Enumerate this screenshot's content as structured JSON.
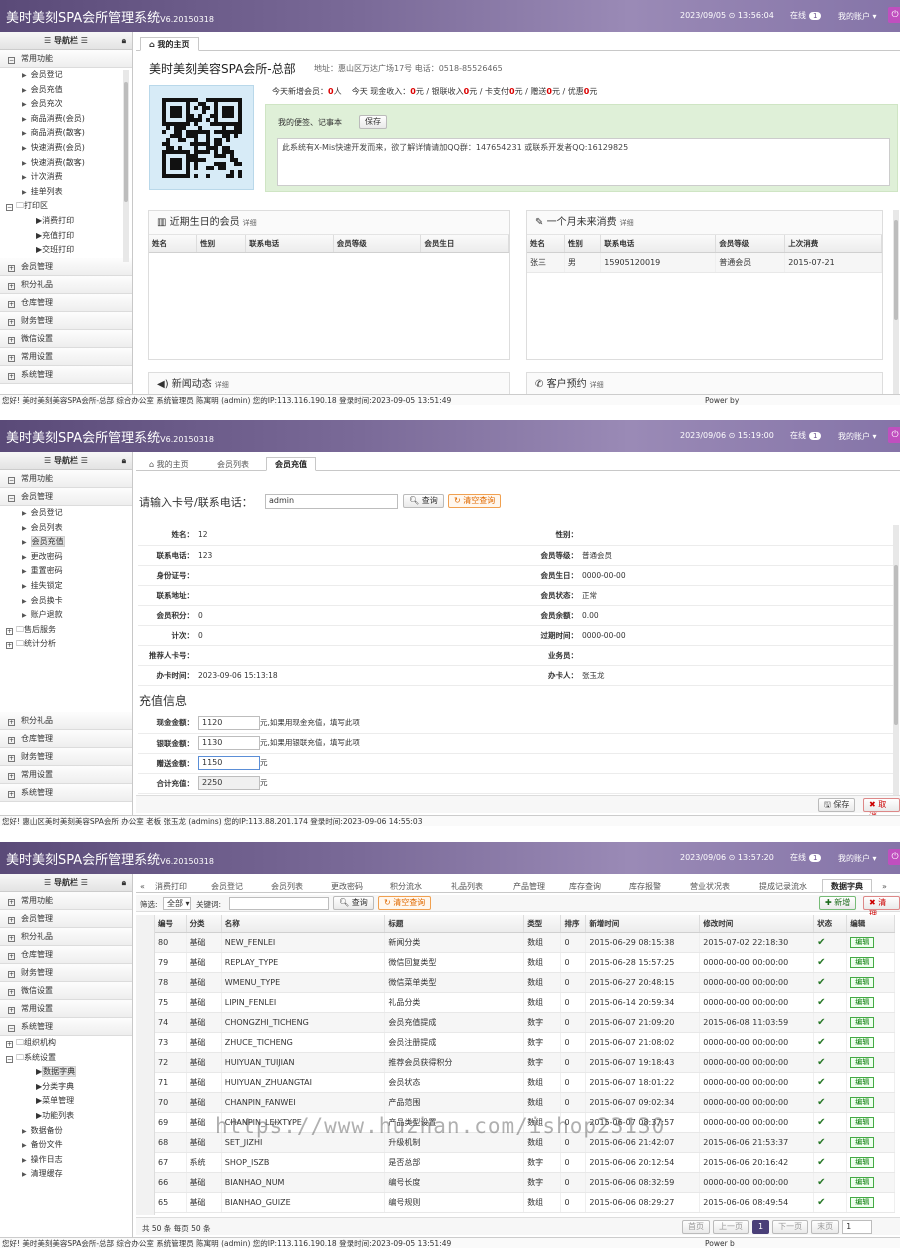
{
  "app_title": "美时美刻SPA会所管理系统",
  "app_version": "V6.20150318",
  "nav_header": "导航栏",
  "online_label": "在线",
  "account_label": "我的账户",
  "s1": {
    "datetime": "2023/09/05 ⊙ 13:56:04",
    "online_count": "1",
    "groups_top": [
      "常用功能"
    ],
    "sub_items": [
      "会员登记",
      "会员充值",
      "会员充次",
      "商品消费(会员)",
      "商品消费(散客)",
      "快速消费(会员)",
      "快速消费(散客)",
      "计次消费",
      "挂单列表"
    ],
    "print_folder": "打印区",
    "print_items": [
      "消费打印",
      "充值打印",
      "交班打印"
    ],
    "groups_bottom": [
      "会员管理",
      "积分礼品",
      "仓库管理",
      "财务管理",
      "微信设置",
      "常用设置",
      "系统管理"
    ],
    "tab": "我的主页",
    "store_name": "美时美刻美容SPA会所-总部",
    "address": "地址：惠山区万达广场17号 电话：0518-85526465",
    "stats": {
      "new_members_label": "今天新增会员：",
      "new_members": "0",
      "new_members_unit": "人",
      "cash_label": "今天 现金收入：",
      "cash": "0",
      "unit": "元",
      "union_label": "/ 银联收入",
      "union": "0",
      "card_label": "/ 卡支付",
      "card": "0",
      "gift_label": "/ 赠送",
      "gift": "0",
      "discount_label": "/ 优惠",
      "discount": "0"
    },
    "memo_label": "我的便签、记事本",
    "memo_save": "保存",
    "memo_text": "此系统有X-Mis快速开发而来，欲了解详情请加QQ群：147654231  或联系开发者QQ:16129825",
    "birthday_title": "近期生日的会员",
    "detail": "详细",
    "birthday_cols": [
      "姓名",
      "性别",
      "联系电话",
      "会员等级",
      "会员生日"
    ],
    "consume_title": "一个月未来消费",
    "consume_cols": [
      "姓名",
      "性别",
      "联系电话",
      "会员等级",
      "上次消费"
    ],
    "consume_rows": [
      [
        "张三",
        "男",
        "15905120019",
        "普通会员",
        "2015-07-21"
      ]
    ],
    "news_title": "新闻动态",
    "appoint_title": "客户预约",
    "status": "您好! 美时美刻美容SPA会所-总部 综合办公室 系统管理员 陈寓明 (admin) 您的IP:113.116.190.18 登录时间:2023-09-05 13:51:49",
    "powered": "Power by"
  },
  "s2": {
    "datetime": "2023/09/06 ⊙ 15:19:00",
    "online_count": "1",
    "groups_top": [
      "常用功能",
      "会员管理"
    ],
    "sub_items": [
      "会员登记",
      "会员列表",
      "会员充值",
      "更改密码",
      "重置密码",
      "挂失锁定",
      "会员换卡",
      "账户退款"
    ],
    "folders": [
      "售后服务",
      "统计分析"
    ],
    "groups_bottom": [
      "积分礼品",
      "仓库管理",
      "财务管理",
      "常用设置",
      "系统管理"
    ],
    "tabs": [
      "我的主页",
      "会员列表",
      "会员充值"
    ],
    "search_label": "请输入卡号/联系电话：",
    "search_value": "admin",
    "query": "查询",
    "clear": "清空查询",
    "info": [
      [
        "姓名：",
        "12",
        "性别：",
        ""
      ],
      [
        "联系电话：",
        "123",
        "会员等级：",
        "普通会员"
      ],
      [
        "身份证号：",
        "",
        "会员生日：",
        "0000-00-00"
      ],
      [
        "联系地址：",
        "",
        "会员状态：",
        "正常"
      ],
      [
        "会员积分：",
        "0",
        "会员余额：",
        "0.00"
      ],
      [
        "计次：",
        "0",
        "过期时间：",
        "0000-00-00"
      ],
      [
        "推荐人卡号：",
        "",
        "业务员：",
        ""
      ],
      [
        "办卡时间：",
        "2023-09-06 15:13:18",
        "办卡人：",
        "张玉龙"
      ]
    ],
    "recharge_title": "充值信息",
    "recharge": [
      {
        "label": "现金金额：",
        "value": "1120",
        "note": "元,如果用现金充值，填写此项"
      },
      {
        "label": "银联金额：",
        "value": "1130",
        "note": "元,如果用银联充值，填写此项"
      },
      {
        "label": "赠送金额：",
        "value": "1150",
        "note": "元"
      },
      {
        "label": "合计充值：",
        "value": "2250",
        "note": "元"
      }
    ],
    "save": "保存",
    "cancel": "取消",
    "status": "您好! 惠山区美时美刻美容SPA会所 办公室 老板 张玉龙 (admins) 您的IP:113.88.201.174 登录时间:2023-09-06 14:55:03"
  },
  "s3": {
    "datetime": "2023/09/06 ⊙ 13:57:20",
    "online_count": "1",
    "groups": [
      "常用功能",
      "会员管理",
      "积分礼品",
      "仓库管理",
      "财务管理",
      "微信设置",
      "常用设置",
      "系统管理"
    ],
    "folders": [
      "组织机构",
      "系统设置"
    ],
    "settings_items": [
      "数据字典",
      "分类字典",
      "菜单管理",
      "功能列表"
    ],
    "other_items": [
      "数据备份",
      "备份文件",
      "操作日志",
      "清理缓存"
    ],
    "tabs": [
      "消费打印",
      "会员登记",
      "会员列表",
      "更改密码",
      "积分流水",
      "礼品列表",
      "产品管理",
      "库存查询",
      "库存报警",
      "营业状况表",
      "提成记录流水",
      "数据字典"
    ],
    "filter_label": "筛选:",
    "filter_value": "全部",
    "keyword_label": "关键词:",
    "query": "查询",
    "clear": "清空查询",
    "add": "新增",
    "clean": "清理",
    "cols": [
      "编号",
      "分类",
      "名称",
      "标题",
      "类型",
      "排序",
      "新增时间",
      "修改时间",
      "状态",
      "编辑"
    ],
    "edit_label": "编辑",
    "rows": [
      [
        "80",
        "基础",
        "NEW_FENLEI",
        "新闻分类",
        "数组",
        "0",
        "2015-06-29 08:15:38",
        "2015-07-02 22:18:30"
      ],
      [
        "79",
        "基础",
        "REPLAY_TYPE",
        "微信回复类型",
        "数组",
        "0",
        "2015-06-28 15:57:25",
        "0000-00-00 00:00:00"
      ],
      [
        "78",
        "基础",
        "WMENU_TYPE",
        "微信菜单类型",
        "数组",
        "0",
        "2015-06-27 20:48:15",
        "0000-00-00 00:00:00"
      ],
      [
        "75",
        "基础",
        "LIPIN_FENLEI",
        "礼品分类",
        "数组",
        "0",
        "2015-06-14 20:59:34",
        "0000-00-00 00:00:00"
      ],
      [
        "74",
        "基础",
        "CHONGZHI_TICHENG",
        "会员充值提成",
        "数字",
        "0",
        "2015-06-07 21:09:20",
        "2015-06-08 11:03:59"
      ],
      [
        "73",
        "基础",
        "ZHUCE_TICHENG",
        "会员注册提成",
        "数字",
        "0",
        "2015-06-07 21:08:02",
        "0000-00-00 00:00:00"
      ],
      [
        "72",
        "基础",
        "HUIYUAN_TUIJIAN",
        "推荐会员获得积分",
        "数字",
        "0",
        "2015-06-07 19:18:43",
        "0000-00-00 00:00:00"
      ],
      [
        "71",
        "基础",
        "HUIYUAN_ZHUANGTAI",
        "会员状态",
        "数组",
        "0",
        "2015-06-07 18:01:22",
        "0000-00-00 00:00:00"
      ],
      [
        "70",
        "基础",
        "CHANPIN_FANWEI",
        "产品范围",
        "数组",
        "0",
        "2015-06-07 09:02:34",
        "0000-00-00 00:00:00"
      ],
      [
        "69",
        "基础",
        "CHANPIN_LEIXTYPE",
        "产品类型设置",
        "数组",
        "0",
        "2015-06-07 08:37:57",
        "0000-00-00 00:00:00"
      ],
      [
        "68",
        "基础",
        "SET_JIZHI",
        "升级机制",
        "数组",
        "0",
        "2015-06-06 21:42:07",
        "2015-06-06 21:53:37"
      ],
      [
        "67",
        "系统",
        "SHOP_ISZB",
        "是否总部",
        "数字",
        "0",
        "2015-06-06 20:12:54",
        "2015-06-06 20:16:42"
      ],
      [
        "66",
        "基础",
        "BIANHAO_NUM",
        "编号长度",
        "数字",
        "0",
        "2015-06-06 08:32:59",
        "0000-00-00 00:00:00"
      ],
      [
        "65",
        "基础",
        "BIANHAO_GUIZE",
        "编号规则",
        "数组",
        "0",
        "2015-06-06 08:29:27",
        "2015-06-06 08:49:54"
      ]
    ],
    "footer": "共 50 条 每页 50 条",
    "pager": [
      "首页",
      "上一页",
      "1",
      "下一页",
      "末页"
    ],
    "page_input": "1",
    "watermark": "https://www.huzhan.com/ishop23130",
    "status": "您好! 美时美刻美容SPA会所-总部 综合办公室 系统管理员 陈寓明 (admin) 您的IP:113.116.190.18 登录时间:2023-09-05 13:51:49",
    "powered": "Power b"
  }
}
